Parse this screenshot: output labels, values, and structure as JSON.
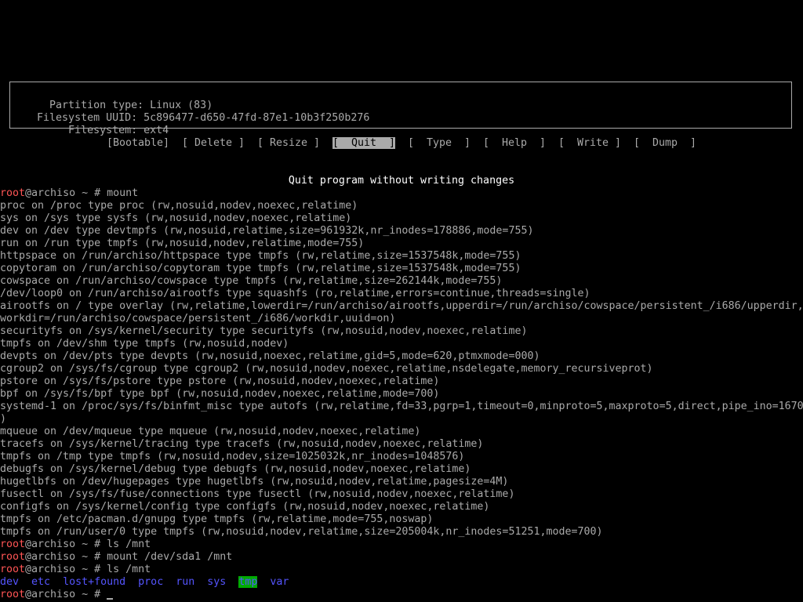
{
  "partition_info": {
    "rows": [
      {
        "label": " Partition type:",
        "value": "Linux (83)"
      },
      {
        "label": "Filesystem UUID:",
        "value": "5c896477-d650-47fd-87e1-10b3f250b276"
      },
      {
        "label": "     Filesystem:",
        "value": "ext4"
      }
    ]
  },
  "menu": {
    "items": [
      {
        "label": "[Bootable]",
        "selected": false
      },
      {
        "label": "[ Delete ]",
        "selected": false
      },
      {
        "label": "[ Resize ]",
        "selected": false
      },
      {
        "label": "[  Quit  ]",
        "selected": true
      },
      {
        "label": "[  Type  ]",
        "selected": false
      },
      {
        "label": "[  Help  ]",
        "selected": false
      },
      {
        "label": "[  Write ]",
        "selected": false
      },
      {
        "label": "[  Dump  ]",
        "selected": false
      }
    ]
  },
  "hint": "Quit program without writing changes",
  "prompt": {
    "user": "root",
    "rest": "@archiso ~ # "
  },
  "commands": {
    "mount": "mount",
    "ls1": "ls /mnt",
    "mount_sda": "mount /dev/sda1 /mnt",
    "ls2": "ls /mnt"
  },
  "mount_output": [
    "proc on /proc type proc (rw,nosuid,nodev,noexec,relatime)",
    "sys on /sys type sysfs (rw,nosuid,nodev,noexec,relatime)",
    "dev on /dev type devtmpfs (rw,nosuid,relatime,size=961932k,nr_inodes=178886,mode=755)",
    "run on /run type tmpfs (rw,nosuid,nodev,relatime,mode=755)",
    "httpspace on /run/archiso/httpspace type tmpfs (rw,relatime,size=1537548k,mode=755)",
    "copytoram on /run/archiso/copytoram type tmpfs (rw,relatime,size=1537548k,mode=755)",
    "cowspace on /run/archiso/cowspace type tmpfs (rw,relatime,size=262144k,mode=755)",
    "/dev/loop0 on /run/archiso/airootfs type squashfs (ro,relatime,errors=continue,threads=single)",
    "airootfs on / type overlay (rw,relatime,lowerdir=/run/archiso/airootfs,upperdir=/run/archiso/cowspace/persistent_/i686/upperdir,",
    "workdir=/run/archiso/cowspace/persistent_/i686/workdir,uuid=on)",
    "securityfs on /sys/kernel/security type securityfs (rw,nosuid,nodev,noexec,relatime)",
    "tmpfs on /dev/shm type tmpfs (rw,nosuid,nodev)",
    "devpts on /dev/pts type devpts (rw,nosuid,noexec,relatime,gid=5,mode=620,ptmxmode=000)",
    "cgroup2 on /sys/fs/cgroup type cgroup2 (rw,nosuid,nodev,noexec,relatime,nsdelegate,memory_recursiveprot)",
    "pstore on /sys/fs/pstore type pstore (rw,nosuid,nodev,noexec,relatime)",
    "bpf on /sys/fs/bpf type bpf (rw,nosuid,nodev,noexec,relatime,mode=700)",
    "systemd-1 on /proc/sys/fs/binfmt_misc type autofs (rw,relatime,fd=33,pgrp=1,timeout=0,minproto=5,maxproto=5,direct,pipe_ino=1670",
    ")",
    "mqueue on /dev/mqueue type mqueue (rw,nosuid,nodev,noexec,relatime)",
    "tracefs on /sys/kernel/tracing type tracefs (rw,nosuid,nodev,noexec,relatime)",
    "tmpfs on /tmp type tmpfs (rw,nosuid,nodev,size=1025032k,nr_inodes=1048576)",
    "debugfs on /sys/kernel/debug type debugfs (rw,nosuid,nodev,noexec,relatime)",
    "hugetlbfs on /dev/hugepages type hugetlbfs (rw,nosuid,nodev,relatime,pagesize=4M)",
    "fusectl on /sys/fs/fuse/connections type fusectl (rw,nosuid,nodev,noexec,relatime)",
    "configfs on /sys/kernel/config type configfs (rw,nosuid,nodev,noexec,relatime)",
    "tmpfs on /etc/pacman.d/gnupg type tmpfs (rw,relatime,mode=755,noswap)",
    "tmpfs on /run/user/0 type tmpfs (rw,nosuid,nodev,relatime,size=205004k,nr_inodes=51251,mode=700)"
  ],
  "ls_output": [
    "dev",
    "etc",
    "lost+found",
    "proc",
    "run",
    "sys",
    "tmp",
    "var"
  ],
  "ls_highlighted": "tmp",
  "colors": {
    "foreground": "#aaaaaa",
    "background": "#000000",
    "prompt_user": "#ff5555",
    "directory": "#5555ff",
    "sticky_dir_bg": "#00aa00",
    "hint": "#ffffff"
  }
}
